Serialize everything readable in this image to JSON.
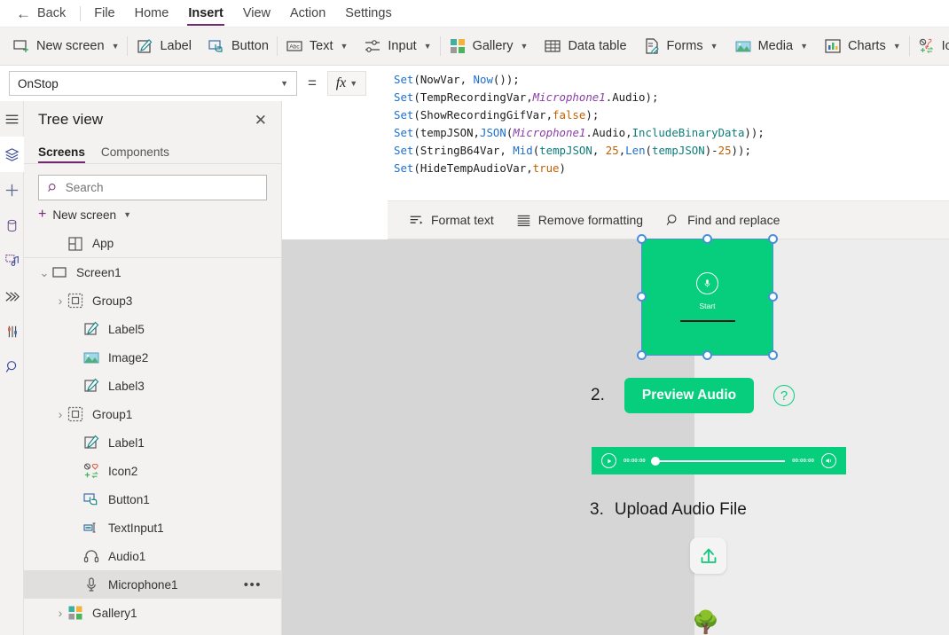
{
  "menubar": {
    "back_label": "Back",
    "items": [
      {
        "label": "File",
        "active": false
      },
      {
        "label": "Home",
        "active": false
      },
      {
        "label": "Insert",
        "active": true
      },
      {
        "label": "View",
        "active": false
      },
      {
        "label": "Action",
        "active": false
      },
      {
        "label": "Settings",
        "active": false
      }
    ]
  },
  "ribbon": {
    "items": [
      {
        "label": "New screen",
        "icon": "new-screen-icon",
        "caret": true
      },
      {
        "label": "Label",
        "icon": "label-icon",
        "caret": false
      },
      {
        "label": "Button",
        "icon": "button-icon",
        "caret": false
      },
      {
        "label": "Text",
        "icon": "text-icon",
        "caret": true
      },
      {
        "label": "Input",
        "icon": "input-icon",
        "caret": true
      },
      {
        "label": "Gallery",
        "icon": "gallery-icon",
        "caret": true
      },
      {
        "label": "Data table",
        "icon": "data-table-icon",
        "caret": false
      },
      {
        "label": "Forms",
        "icon": "forms-icon",
        "caret": true
      },
      {
        "label": "Media",
        "icon": "media-icon",
        "caret": true
      },
      {
        "label": "Charts",
        "icon": "charts-icon",
        "caret": true
      },
      {
        "label": "Ic",
        "icon": "icons-icon",
        "caret": false
      }
    ]
  },
  "formula": {
    "property": "OnStop",
    "equals": "=",
    "fx_label": "fx",
    "code_lines": [
      [
        {
          "t": "Set",
          "c": "fn"
        },
        {
          "t": "(NowVar, ",
          "c": "pl"
        },
        {
          "t": "Now",
          "c": "fn"
        },
        {
          "t": "());",
          "c": "pl"
        }
      ],
      [
        {
          "t": "Set",
          "c": "fn"
        },
        {
          "t": "(TempRecordingVar,",
          "c": "pl"
        },
        {
          "t": "Microphone1",
          "c": "ctrl"
        },
        {
          "t": ".Audio);",
          "c": "pl"
        }
      ],
      [
        {
          "t": "Set",
          "c": "fn"
        },
        {
          "t": "(ShowRecordingGifVar,",
          "c": "pl"
        },
        {
          "t": "false",
          "c": "bool"
        },
        {
          "t": ");",
          "c": "pl"
        }
      ],
      [
        {
          "t": "Set",
          "c": "fn"
        },
        {
          "t": "(tempJSON,",
          "c": "pl"
        },
        {
          "t": "JSON",
          "c": "fn"
        },
        {
          "t": "(",
          "c": "pl"
        },
        {
          "t": "Microphone1",
          "c": "ctrl"
        },
        {
          "t": ".Audio,",
          "c": "pl"
        },
        {
          "t": "IncludeBinaryData",
          "c": "id"
        },
        {
          "t": "));",
          "c": "pl"
        }
      ],
      [
        {
          "t": "Set",
          "c": "fn"
        },
        {
          "t": "(StringB64Var, ",
          "c": "pl"
        },
        {
          "t": "Mid",
          "c": "fn"
        },
        {
          "t": "(",
          "c": "pl"
        },
        {
          "t": "tempJSON",
          "c": "id"
        },
        {
          "t": ", ",
          "c": "pl"
        },
        {
          "t": "25",
          "c": "num"
        },
        {
          "t": ",",
          "c": "pl"
        },
        {
          "t": "Len",
          "c": "fn"
        },
        {
          "t": "(",
          "c": "pl"
        },
        {
          "t": "tempJSON",
          "c": "id"
        },
        {
          "t": ")-",
          "c": "pl"
        },
        {
          "t": "25",
          "c": "num"
        },
        {
          "t": "));",
          "c": "pl"
        }
      ],
      [
        {
          "t": "Set",
          "c": "fn"
        },
        {
          "t": "(HideTempAudioVar,",
          "c": "pl"
        },
        {
          "t": "true",
          "c": "bool"
        },
        {
          "t": ")",
          "c": "pl"
        }
      ]
    ],
    "footer": [
      {
        "label": "Format text",
        "icon": "format-text-icon"
      },
      {
        "label": "Remove formatting",
        "icon": "remove-formatting-icon"
      },
      {
        "label": "Find and replace",
        "icon": "search-icon"
      }
    ]
  },
  "rail": {
    "items": [
      {
        "icon": "hamburger-icon",
        "active": false
      },
      {
        "icon": "tree-view-icon",
        "active": true
      },
      {
        "icon": "insert-plus-icon",
        "active": false
      },
      {
        "icon": "data-icon",
        "active": false
      },
      {
        "icon": "media-library-icon",
        "active": false
      },
      {
        "icon": "power-automate-icon",
        "active": false
      },
      {
        "icon": "variables-icon",
        "active": false
      },
      {
        "icon": "search-icon",
        "active": false
      }
    ]
  },
  "treeview": {
    "title": "Tree view",
    "close_icon": "close-icon",
    "tabs": [
      {
        "label": "Screens",
        "active": true
      },
      {
        "label": "Components",
        "active": false
      }
    ],
    "search_placeholder": "Search",
    "search_value": "",
    "new_screen_label": "New screen",
    "items": [
      {
        "label": "App",
        "icon": "app-icon",
        "indent": 1,
        "arrow": "none",
        "selected": false,
        "divider": true,
        "dots": false
      },
      {
        "label": "Screen1",
        "icon": "screen-icon",
        "indent": 0,
        "arrow": "expanded",
        "selected": false,
        "divider": false,
        "dots": false
      },
      {
        "label": "Group3",
        "icon": "group-icon",
        "indent": 1,
        "arrow": "collapsed",
        "selected": false,
        "divider": false,
        "dots": false
      },
      {
        "label": "Label5",
        "icon": "label-icon",
        "indent": 2,
        "arrow": "none",
        "selected": false,
        "divider": false,
        "dots": false
      },
      {
        "label": "Image2",
        "icon": "image-icon",
        "indent": 2,
        "arrow": "none",
        "selected": false,
        "divider": false,
        "dots": false
      },
      {
        "label": "Label3",
        "icon": "label-icon",
        "indent": 2,
        "arrow": "none",
        "selected": false,
        "divider": false,
        "dots": false
      },
      {
        "label": "Group1",
        "icon": "group-icon",
        "indent": 1,
        "arrow": "collapsed",
        "selected": false,
        "divider": false,
        "dots": false
      },
      {
        "label": "Label1",
        "icon": "label-icon",
        "indent": 2,
        "arrow": "none",
        "selected": false,
        "divider": false,
        "dots": false
      },
      {
        "label": "Icon2",
        "icon": "icons-icon",
        "indent": 2,
        "arrow": "none",
        "selected": false,
        "divider": false,
        "dots": false
      },
      {
        "label": "Button1",
        "icon": "button-icon",
        "indent": 2,
        "arrow": "none",
        "selected": false,
        "divider": false,
        "dots": false
      },
      {
        "label": "TextInput1",
        "icon": "textinput-icon",
        "indent": 2,
        "arrow": "none",
        "selected": false,
        "divider": false,
        "dots": false
      },
      {
        "label": "Audio1",
        "icon": "audio-icon",
        "indent": 2,
        "arrow": "none",
        "selected": false,
        "divider": false,
        "dots": false
      },
      {
        "label": "Microphone1",
        "icon": "microphone-icon",
        "indent": 2,
        "arrow": "none",
        "selected": true,
        "divider": false,
        "dots": true
      },
      {
        "label": "Gallery1",
        "icon": "gallery-icon",
        "indent": 1,
        "arrow": "collapsed",
        "selected": false,
        "divider": false,
        "dots": false
      }
    ]
  },
  "canvas": {
    "accent_green": "#06CE7C",
    "selection_color": "#4a90d9",
    "mic_control": {
      "icon": "microphone-icon",
      "label": "Start",
      "selected": true
    },
    "step2": {
      "number": "2.",
      "button_label": "Preview Audio",
      "help_icon": "question-mark-icon",
      "help_label": "?"
    },
    "player": {
      "play_icon": "play-icon",
      "current_time": "00:00:00",
      "total_time": "00:00:00",
      "volume_icon": "volume-icon",
      "progress_percent": 0
    },
    "step3": {
      "number": "3.",
      "title": "Upload Audio File",
      "upload_icon": "upload-icon",
      "tree_icon": "tree-icon",
      "tree_glyph": "🌳"
    }
  }
}
